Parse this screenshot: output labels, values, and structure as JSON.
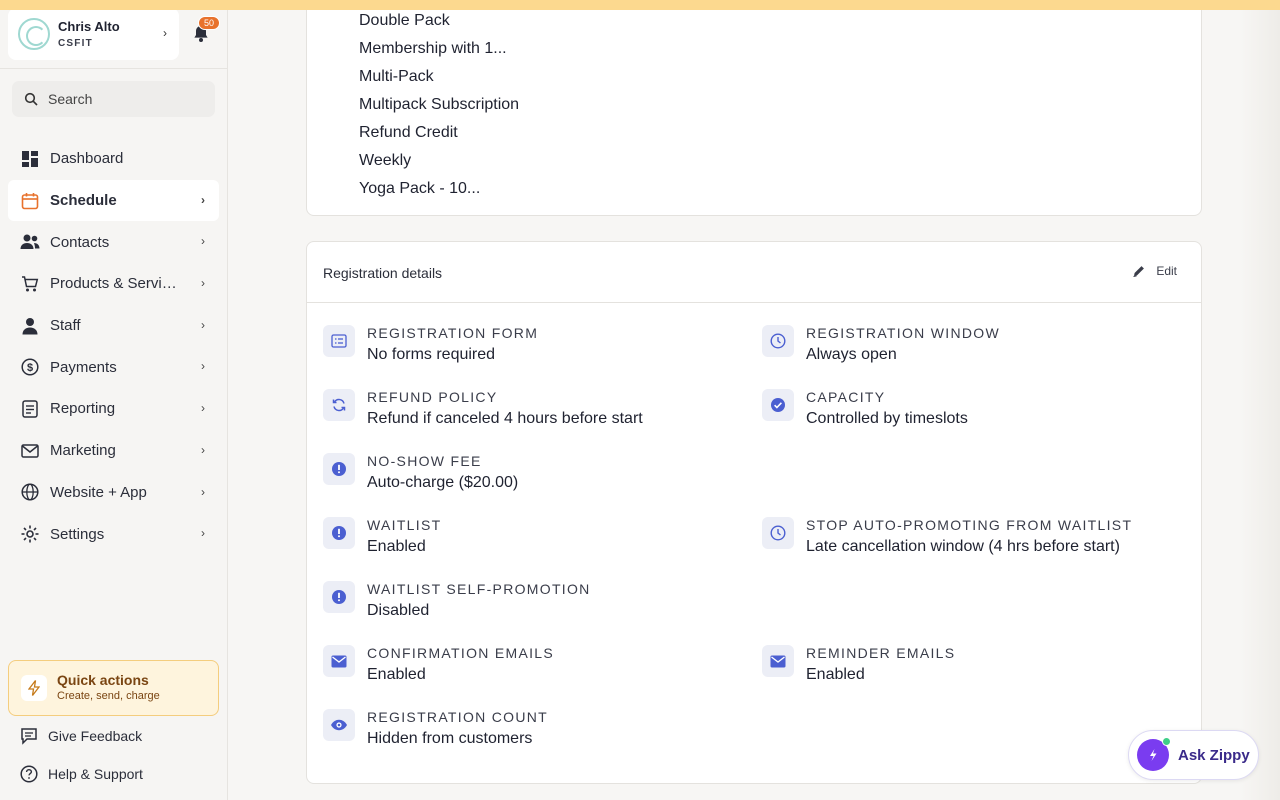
{
  "account": {
    "name": "Chris Alto",
    "org": "CSFIT",
    "notifications": "50"
  },
  "search": {
    "placeholder": "Search"
  },
  "nav": [
    {
      "label": "Dashboard",
      "icon": "dashboard-icon"
    },
    {
      "label": "Schedule",
      "icon": "calendar-icon",
      "active": true
    },
    {
      "label": "Contacts",
      "icon": "contacts-icon"
    },
    {
      "label": "Products & Services",
      "icon": "cart-icon"
    },
    {
      "label": "Staff",
      "icon": "person-icon"
    },
    {
      "label": "Payments",
      "icon": "dollar-icon"
    },
    {
      "label": "Reporting",
      "icon": "report-icon"
    },
    {
      "label": "Marketing",
      "icon": "mail-icon"
    },
    {
      "label": "Website + App",
      "icon": "globe-icon"
    },
    {
      "label": "Settings",
      "icon": "gear-icon"
    }
  ],
  "quick_actions": {
    "title": "Quick actions",
    "subtitle": "Create, send, charge"
  },
  "footer": {
    "feedback": "Give Feedback",
    "help": "Help & Support"
  },
  "pricing_list": [
    "Double Pack",
    "Membership with 1...",
    "Multi-Pack",
    "Multipack Subscription",
    "Refund Credit",
    "Weekly",
    "Yoga Pack - 10..."
  ],
  "registration": {
    "title": "Registration details",
    "edit_label": "Edit",
    "details": [
      {
        "label": "Registration form",
        "value": "No forms required",
        "icon": "form-icon"
      },
      {
        "label": "Registration window",
        "value": "Always open",
        "icon": "clock-icon"
      },
      {
        "label": "Refund policy",
        "value": "Refund if canceled 4 hours before start",
        "icon": "refresh-icon"
      },
      {
        "label": "Capacity",
        "value": "Controlled by timeslots",
        "icon": "check-circle-icon"
      },
      {
        "label": "No-show fee",
        "value": "Auto-charge ($20.00)",
        "icon": "alert-icon"
      },
      {
        "label": "Waitlist",
        "value": "Enabled",
        "icon": "alert-icon"
      },
      {
        "label": "Stop auto-promoting from waitlist",
        "value": "Late cancellation window (4 hrs before start)",
        "icon": "clock-icon"
      },
      {
        "label": "Waitlist self-promotion",
        "value": "Disabled",
        "icon": "alert-icon"
      },
      {
        "label": "Confirmation emails",
        "value": "Enabled",
        "icon": "envelope-icon"
      },
      {
        "label": "Reminder emails",
        "value": "Enabled",
        "icon": "envelope-icon"
      },
      {
        "label": "Registration count",
        "value": "Hidden from customers",
        "icon": "eye-icon"
      }
    ]
  },
  "assistant": {
    "label": "Ask Zippy"
  },
  "colors": {
    "accent": "#4b5fd1",
    "brand_orange": "#e8722c",
    "zippy_purple": "#7a3cf0"
  }
}
